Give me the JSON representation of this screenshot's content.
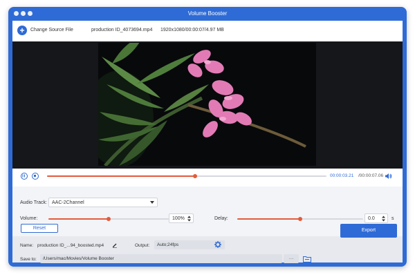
{
  "window": {
    "title": "Volume Booster"
  },
  "toolbar": {
    "change_source_label": "Change Source File",
    "file_name": "production ID_4073694.mp4",
    "file_info": "1920x1080/00:00:07/4.97 MB"
  },
  "player": {
    "current_time": "00:00:03.21",
    "total_time": "/00:00:07.06",
    "progress_fraction": 0.53
  },
  "audio": {
    "track_label": "Audio Track:",
    "track_value": "AAC-2Channel",
    "volume_label": "Volume:",
    "volume_value": "100%",
    "volume_fraction": 0.5,
    "delay_label": "Delay:",
    "delay_value": "0.0",
    "delay_fraction": 0.5,
    "delay_unit": "s",
    "reset_label": "Reset"
  },
  "output": {
    "name_label": "Name:",
    "name_value": "production ID_...94_boosted.mp4",
    "output_label": "Output:",
    "output_value": "Auto;24fps",
    "save_label": "Save to:",
    "save_path": "/Users/mac/Movies/Volume Booster",
    "more_label": "···",
    "export_label": "Export"
  },
  "colors": {
    "accent": "#2f6bd6",
    "slider": "#e35a3b"
  }
}
